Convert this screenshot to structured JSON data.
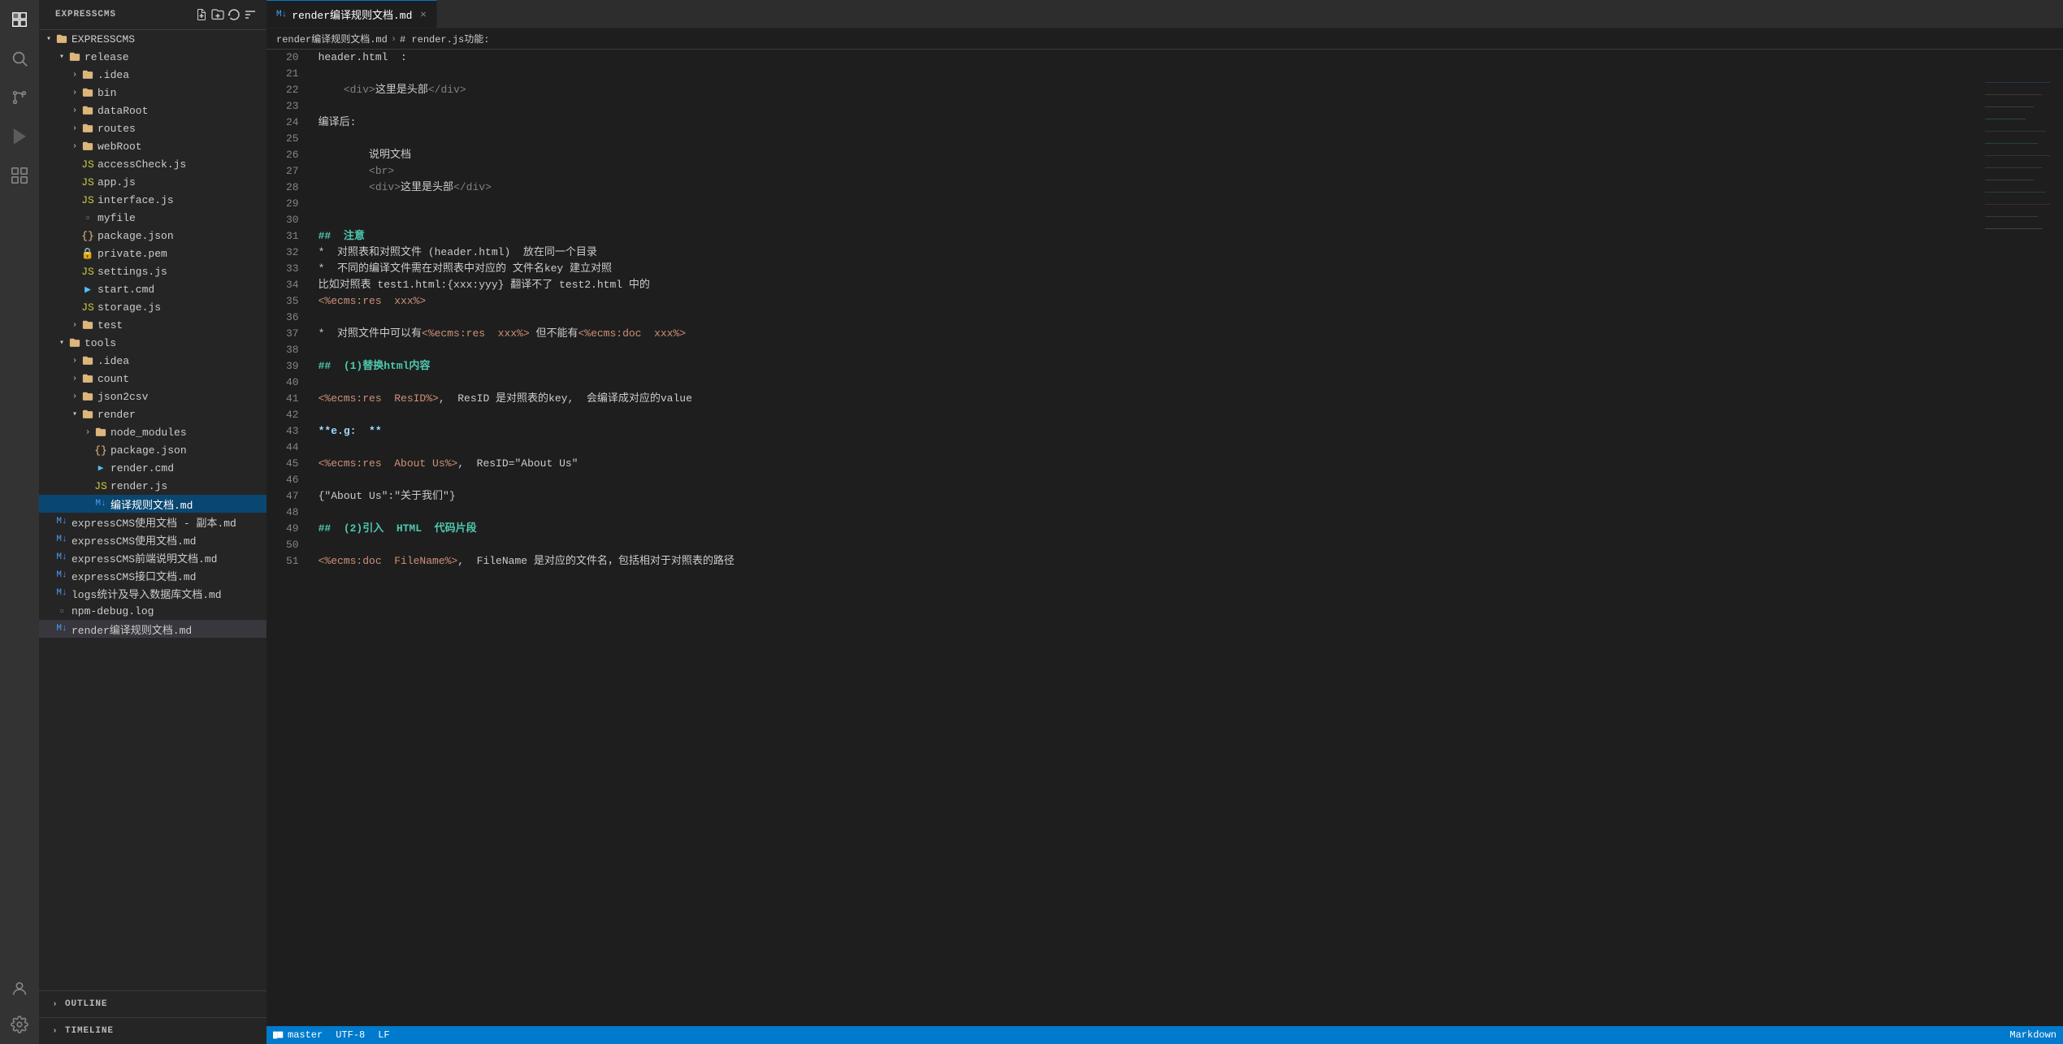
{
  "app": {
    "title": "EXPRESSCMS"
  },
  "activity_bar": {
    "icons": [
      {
        "name": "explorer-icon",
        "symbol": "⊞",
        "active": true
      },
      {
        "name": "search-icon",
        "symbol": "🔍",
        "active": false
      },
      {
        "name": "source-control-icon",
        "symbol": "⑂",
        "active": false
      },
      {
        "name": "debug-icon",
        "symbol": "▷",
        "active": false
      },
      {
        "name": "extensions-icon",
        "symbol": "⊡",
        "active": false
      }
    ],
    "bottom_icons": [
      {
        "name": "account-icon",
        "symbol": "◯"
      },
      {
        "name": "settings-icon",
        "symbol": "⚙"
      }
    ]
  },
  "sidebar": {
    "header": "EXPRESSCMS",
    "toolbar_icons": [
      {
        "name": "new-file-icon",
        "symbol": "📄"
      },
      {
        "name": "new-folder-icon",
        "symbol": "📁"
      },
      {
        "name": "refresh-icon",
        "symbol": "↻"
      },
      {
        "name": "collapse-icon",
        "symbol": "⊟"
      }
    ],
    "tree": [
      {
        "level": 0,
        "type": "folder-open",
        "label": "release",
        "expanded": true,
        "indent": 0
      },
      {
        "level": 1,
        "type": "folder",
        "label": ".idea",
        "indent": 1
      },
      {
        "level": 1,
        "type": "folder",
        "label": "bin",
        "indent": 1
      },
      {
        "level": 1,
        "type": "folder",
        "label": "dataRoot",
        "indent": 1
      },
      {
        "level": 1,
        "type": "folder",
        "label": "routes",
        "indent": 1
      },
      {
        "level": 1,
        "type": "folder",
        "label": "webRoot",
        "indent": 1
      },
      {
        "level": 1,
        "type": "js",
        "label": "accessCheck.js",
        "indent": 1
      },
      {
        "level": 1,
        "type": "js",
        "label": "app.js",
        "indent": 1
      },
      {
        "level": 1,
        "type": "js",
        "label": "interface.js",
        "indent": 1
      },
      {
        "level": 1,
        "type": "file",
        "label": "myfile",
        "indent": 1
      },
      {
        "level": 1,
        "type": "json",
        "label": "package.json",
        "indent": 1
      },
      {
        "level": 1,
        "type": "cert",
        "label": "private.pem",
        "indent": 1
      },
      {
        "level": 1,
        "type": "js",
        "label": "settings.js",
        "indent": 1
      },
      {
        "level": 1,
        "type": "cmd",
        "label": "start.cmd",
        "indent": 1
      },
      {
        "level": 1,
        "type": "js",
        "label": "storage.js",
        "indent": 1
      },
      {
        "level": 1,
        "type": "folder",
        "label": "test",
        "indent": 1
      },
      {
        "level": 0,
        "type": "folder-open",
        "label": "tools",
        "expanded": true,
        "indent": 0
      },
      {
        "level": 1,
        "type": "folder",
        "label": ".idea",
        "indent": 1
      },
      {
        "level": 1,
        "type": "folder",
        "label": "count",
        "indent": 1
      },
      {
        "level": 1,
        "type": "folder",
        "label": "json2csv",
        "indent": 1
      },
      {
        "level": 1,
        "type": "folder-open",
        "label": "render",
        "expanded": true,
        "indent": 1
      },
      {
        "level": 2,
        "type": "folder",
        "label": "node_modules",
        "indent": 2
      },
      {
        "level": 2,
        "type": "json",
        "label": "package.json",
        "indent": 2
      },
      {
        "level": 2,
        "type": "cmd",
        "label": "render.cmd",
        "indent": 2
      },
      {
        "level": 2,
        "type": "js",
        "label": "render.js",
        "indent": 2
      },
      {
        "level": 2,
        "type": "md",
        "label": "编译规则文档.md",
        "indent": 2,
        "selected": true
      },
      {
        "level": 0,
        "type": "md",
        "label": "expressCMS使用文档 - 副本.md",
        "indent": 0
      },
      {
        "level": 0,
        "type": "md",
        "label": "expressCMS使用文档.md",
        "indent": 0
      },
      {
        "level": 0,
        "type": "md",
        "label": "expressCMS前端说明文档.md",
        "indent": 0
      },
      {
        "level": 0,
        "type": "md",
        "label": "expressCMS接口文档.md",
        "indent": 0
      },
      {
        "level": 0,
        "type": "md",
        "label": "logs统计及导入数据库文档.md",
        "indent": 0
      },
      {
        "level": 0,
        "type": "file",
        "label": "npm-debug.log",
        "indent": 0
      },
      {
        "level": 0,
        "type": "md",
        "label": "render编译规则文档.md",
        "indent": 0,
        "selected": true
      }
    ],
    "outline_label": "OUTLINE",
    "timeline_label": "TIMELINE"
  },
  "tabs": [
    {
      "label": "render编译规则文档.md",
      "active": true,
      "icon": "md",
      "modified": false
    }
  ],
  "breadcrumb": {
    "parts": [
      "render编译规则文档.md",
      "# render.js功能:"
    ]
  },
  "editor": {
    "lines": [
      {
        "num": 20,
        "content": "header.html  :"
      },
      {
        "num": 21,
        "content": ""
      },
      {
        "num": 22,
        "content": "    <div>这里是头部</div>"
      },
      {
        "num": 23,
        "content": ""
      },
      {
        "num": 24,
        "content": "编译后:"
      },
      {
        "num": 25,
        "content": ""
      },
      {
        "num": 26,
        "content": "        说明文档"
      },
      {
        "num": 27,
        "content": "        <br>"
      },
      {
        "num": 28,
        "content": "        <div>这里是头部</div>"
      },
      {
        "num": 29,
        "content": ""
      },
      {
        "num": 30,
        "content": ""
      },
      {
        "num": 31,
        "content": "##  注意",
        "type": "heading"
      },
      {
        "num": 32,
        "content": "*  对照表和对照文件 (header.html)  放在同一个目录",
        "type": "bullet"
      },
      {
        "num": 33,
        "content": "*  不同的编译文件需在对照表中对应的 文件名key 建立对照",
        "type": "bullet"
      },
      {
        "num": 34,
        "content": "比如对照表 test1.html:{xxx:yyy} 翻译不了 test2.html 中的",
        "type": "text"
      },
      {
        "num": 35,
        "content": "<%ecms:res  xxx%>",
        "type": "code"
      },
      {
        "num": 36,
        "content": ""
      },
      {
        "num": 37,
        "content": "*  对照文件中可以有<%ecms:res  xxx%> 但不能有<%ecms:doc  xxx%>",
        "type": "bullet"
      },
      {
        "num": 38,
        "content": ""
      },
      {
        "num": 39,
        "content": "##  (1)替换html内容",
        "type": "heading2"
      },
      {
        "num": 40,
        "content": ""
      },
      {
        "num": 41,
        "content": "<%ecms:res  ResID%>,  ResID 是对照表的key,  会编译成对应的value",
        "type": "text"
      },
      {
        "num": 42,
        "content": ""
      },
      {
        "num": 43,
        "content": "**e.g:  **",
        "type": "bold"
      },
      {
        "num": 44,
        "content": ""
      },
      {
        "num": 45,
        "content": "<%ecms:res  About Us%>,  ResID=\"About Us\"",
        "type": "code"
      },
      {
        "num": 46,
        "content": ""
      },
      {
        "num": 47,
        "content": "{\"About Us\":\"关于我们\"}",
        "type": "json"
      },
      {
        "num": 48,
        "content": ""
      },
      {
        "num": 49,
        "content": "##  (2)引入  HTML  代码片段",
        "type": "heading2"
      },
      {
        "num": 50,
        "content": ""
      },
      {
        "num": 51,
        "content": "<%ecms:doc  FileName%>,  FileName 是对应的文件名，包括相对于对照表的路径",
        "type": "text"
      }
    ]
  }
}
